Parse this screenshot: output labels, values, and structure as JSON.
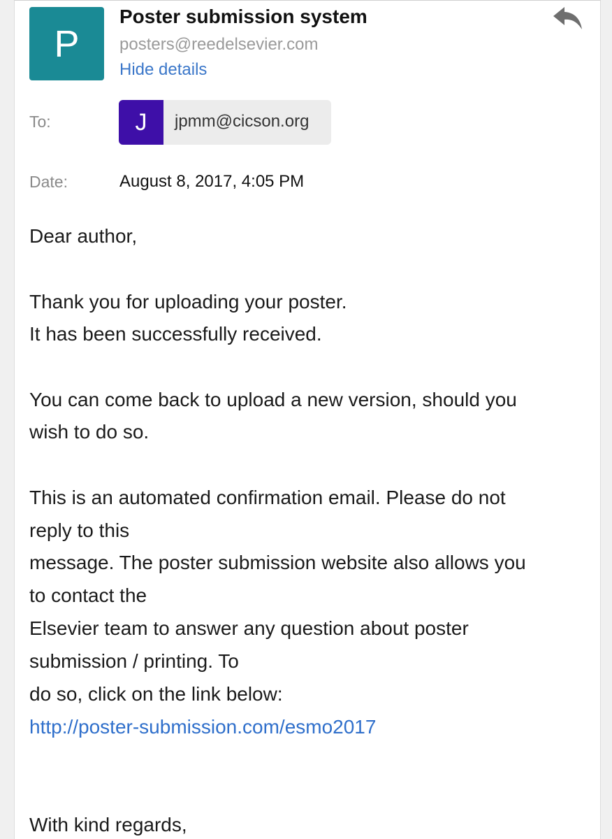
{
  "sender": {
    "avatar_letter": "P",
    "name": "Poster submission system",
    "email": "posters@reedelsevier.com",
    "hide_details": "Hide details",
    "reply_icon": "reply-arrow-icon"
  },
  "meta": {
    "to_label": "To:",
    "recipient_letter": "J",
    "recipient_email": "jpmm@cicson.org",
    "date_label": "Date:",
    "date_value": "August 8, 2017, 4:05 PM"
  },
  "body": {
    "greeting": "Dear author,",
    "thanks_1": "Thank you for uploading your poster.",
    "thanks_2": "It has been successfully received.",
    "version_1": "You can come back to upload a new version, should you",
    "version_2": "wish to do so.",
    "auto_1": "This is an automated confirmation email. Please do not",
    "auto_2": "reply to this",
    "auto_3": "message. The poster submission website also allows you",
    "auto_4": "to contact the",
    "auto_5": "Elsevier team to answer any question about poster",
    "auto_6": "submission / printing. To",
    "auto_7": "do so, click on the link below:",
    "link": "http://poster-submission.com/esmo2017",
    "closing": "With kind regards,"
  },
  "colors": {
    "sender_avatar": "#1a8a95",
    "recipient_avatar": "#3e0fa8",
    "link": "#2f6fcb"
  }
}
